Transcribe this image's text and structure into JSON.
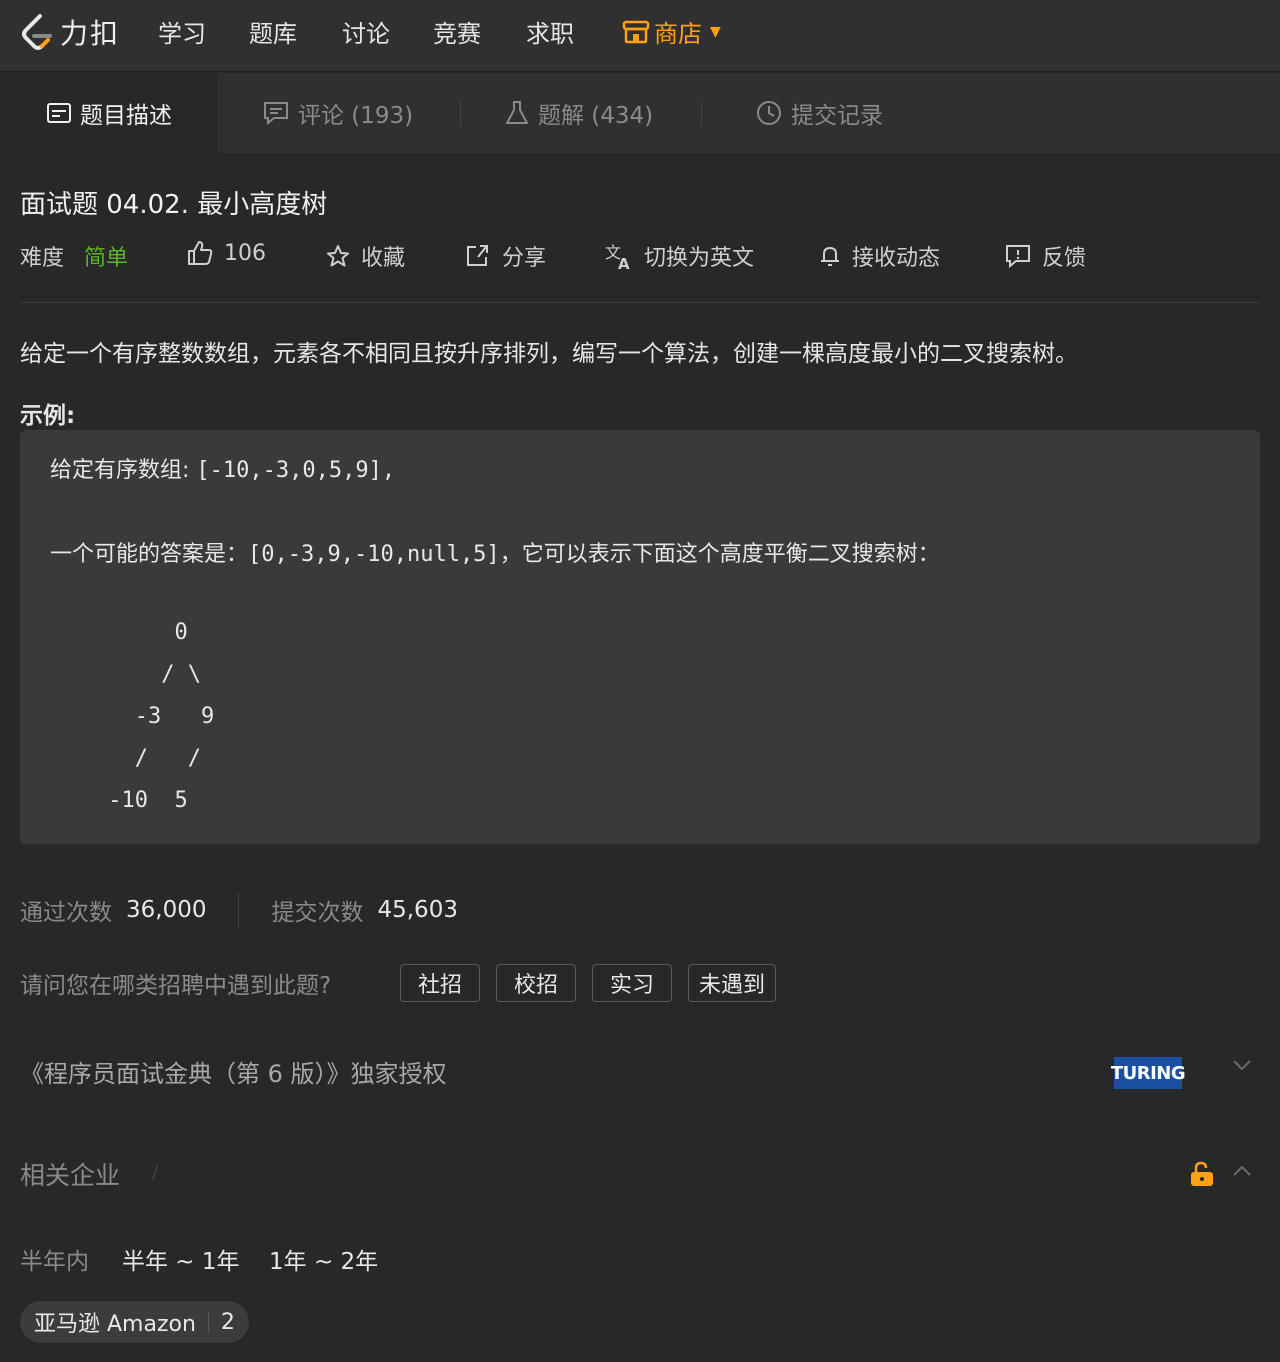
{
  "nav": {
    "logo_text": "力扣",
    "items": [
      "学习",
      "题库",
      "讨论",
      "竞赛",
      "求职"
    ],
    "shop_label": "商店",
    "accent_color": "#ffa116"
  },
  "tabs": [
    {
      "label": "题目描述",
      "icon": "description-icon"
    },
    {
      "label": "评论 (193)",
      "icon": "comment-icon"
    },
    {
      "label": "题解 (434)",
      "icon": "flask-icon"
    },
    {
      "label": "提交记录",
      "icon": "clock-icon"
    }
  ],
  "problem": {
    "title": "面试题 04.02. 最小高度树",
    "difficulty_label": "难度",
    "difficulty": "简单",
    "difficulty_color": "#5ab726",
    "likes": "106",
    "favorite_label": "收藏",
    "share_label": "分享",
    "translate_label": "切换为英文",
    "subscribe_label": "接收动态",
    "feedback_label": "反馈"
  },
  "description": "给定一个有序整数数组，元素各不相同且按升序排列，编写一个算法，创建一棵高度最小的二叉搜索树。",
  "example": {
    "label": "示例:",
    "line1_prefix": "给定有序数组: ",
    "line1_code": "[-10,-3,0,5,9],",
    "line2_prefix": "一个可能的答案是：",
    "line2_code": "[0,-3,9,-10,null,5]",
    "line2_suffix": "，它可以表示下面这个高度平衡二叉搜索树：",
    "tree": [
      "      0",
      "     / \\",
      "   -3   9",
      "   /   /",
      " -10  5"
    ]
  },
  "stats": {
    "accepted_label": "通过次数",
    "accepted": "36,000",
    "submitted_label": "提交次数",
    "submitted": "45,603"
  },
  "survey": {
    "question": "请问您在哪类招聘中遇到此题?",
    "options": [
      "社招",
      "校招",
      "实习",
      "未遇到"
    ]
  },
  "book": {
    "text": "《程序员面试金典（第 6 版）》独家授权",
    "publisher_logo": "TURING"
  },
  "companies": {
    "title": "相关企业",
    "time_filters": [
      "半年内",
      "半年 ~ 1年",
      "1年 ~ 2年"
    ],
    "items": [
      {
        "name": "亚马逊 Amazon",
        "count": "2"
      }
    ]
  }
}
